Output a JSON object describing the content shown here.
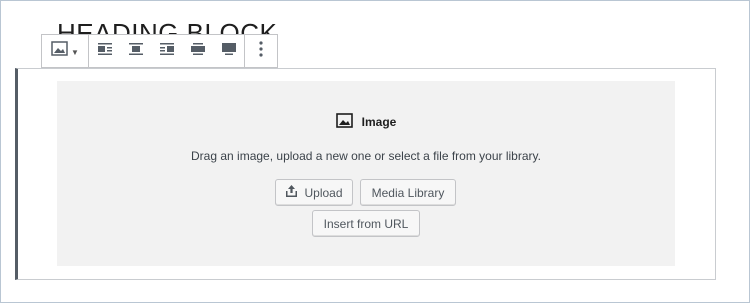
{
  "heading": {
    "text": "HEADING BLOCK"
  },
  "toolbar": {
    "image_switcher_icon": "image-icon",
    "align_buttons": [
      {
        "icon": "align-left-icon"
      },
      {
        "icon": "align-center-icon"
      },
      {
        "icon": "align-right-icon"
      },
      {
        "icon": "align-wide-icon"
      },
      {
        "icon": "align-full-icon"
      }
    ],
    "more_icon": "more-vertical-icon"
  },
  "placeholder": {
    "label": "Image",
    "instructions": "Drag an image, upload a new one or select a file from your library.",
    "upload_label": "Upload",
    "media_library_label": "Media Library",
    "insert_url_label": "Insert from URL"
  }
}
